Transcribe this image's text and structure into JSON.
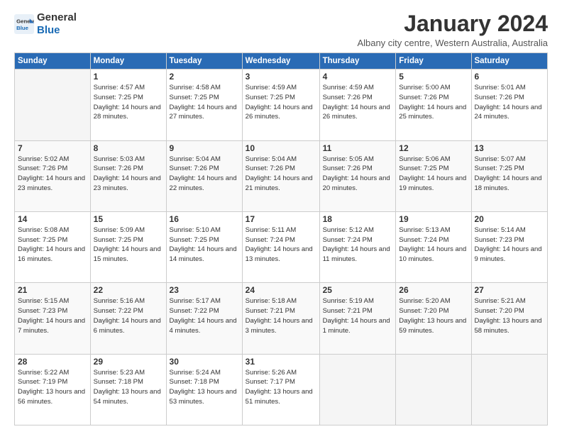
{
  "logo": {
    "line1": "General",
    "line2": "Blue"
  },
  "title": "January 2024",
  "subtitle": "Albany city centre, Western Australia, Australia",
  "days_header": [
    "Sunday",
    "Monday",
    "Tuesday",
    "Wednesday",
    "Thursday",
    "Friday",
    "Saturday"
  ],
  "weeks": [
    [
      {
        "num": "",
        "empty": true
      },
      {
        "num": "1",
        "rise": "4:57 AM",
        "set": "7:25 PM",
        "daylight": "14 hours and 28 minutes."
      },
      {
        "num": "2",
        "rise": "4:58 AM",
        "set": "7:25 PM",
        "daylight": "14 hours and 27 minutes."
      },
      {
        "num": "3",
        "rise": "4:59 AM",
        "set": "7:25 PM",
        "daylight": "14 hours and 26 minutes."
      },
      {
        "num": "4",
        "rise": "4:59 AM",
        "set": "7:26 PM",
        "daylight": "14 hours and 26 minutes."
      },
      {
        "num": "5",
        "rise": "5:00 AM",
        "set": "7:26 PM",
        "daylight": "14 hours and 25 minutes."
      },
      {
        "num": "6",
        "rise": "5:01 AM",
        "set": "7:26 PM",
        "daylight": "14 hours and 24 minutes."
      }
    ],
    [
      {
        "num": "7",
        "rise": "5:02 AM",
        "set": "7:26 PM",
        "daylight": "14 hours and 23 minutes."
      },
      {
        "num": "8",
        "rise": "5:03 AM",
        "set": "7:26 PM",
        "daylight": "14 hours and 23 minutes."
      },
      {
        "num": "9",
        "rise": "5:04 AM",
        "set": "7:26 PM",
        "daylight": "14 hours and 22 minutes."
      },
      {
        "num": "10",
        "rise": "5:04 AM",
        "set": "7:26 PM",
        "daylight": "14 hours and 21 minutes."
      },
      {
        "num": "11",
        "rise": "5:05 AM",
        "set": "7:26 PM",
        "daylight": "14 hours and 20 minutes."
      },
      {
        "num": "12",
        "rise": "5:06 AM",
        "set": "7:25 PM",
        "daylight": "14 hours and 19 minutes."
      },
      {
        "num": "13",
        "rise": "5:07 AM",
        "set": "7:25 PM",
        "daylight": "14 hours and 18 minutes."
      }
    ],
    [
      {
        "num": "14",
        "rise": "5:08 AM",
        "set": "7:25 PM",
        "daylight": "14 hours and 16 minutes."
      },
      {
        "num": "15",
        "rise": "5:09 AM",
        "set": "7:25 PM",
        "daylight": "14 hours and 15 minutes."
      },
      {
        "num": "16",
        "rise": "5:10 AM",
        "set": "7:25 PM",
        "daylight": "14 hours and 14 minutes."
      },
      {
        "num": "17",
        "rise": "5:11 AM",
        "set": "7:24 PM",
        "daylight": "14 hours and 13 minutes."
      },
      {
        "num": "18",
        "rise": "5:12 AM",
        "set": "7:24 PM",
        "daylight": "14 hours and 11 minutes."
      },
      {
        "num": "19",
        "rise": "5:13 AM",
        "set": "7:24 PM",
        "daylight": "14 hours and 10 minutes."
      },
      {
        "num": "20",
        "rise": "5:14 AM",
        "set": "7:23 PM",
        "daylight": "14 hours and 9 minutes."
      }
    ],
    [
      {
        "num": "21",
        "rise": "5:15 AM",
        "set": "7:23 PM",
        "daylight": "14 hours and 7 minutes."
      },
      {
        "num": "22",
        "rise": "5:16 AM",
        "set": "7:22 PM",
        "daylight": "14 hours and 6 minutes."
      },
      {
        "num": "23",
        "rise": "5:17 AM",
        "set": "7:22 PM",
        "daylight": "14 hours and 4 minutes."
      },
      {
        "num": "24",
        "rise": "5:18 AM",
        "set": "7:21 PM",
        "daylight": "14 hours and 3 minutes."
      },
      {
        "num": "25",
        "rise": "5:19 AM",
        "set": "7:21 PM",
        "daylight": "14 hours and 1 minute."
      },
      {
        "num": "26",
        "rise": "5:20 AM",
        "set": "7:20 PM",
        "daylight": "13 hours and 59 minutes."
      },
      {
        "num": "27",
        "rise": "5:21 AM",
        "set": "7:20 PM",
        "daylight": "13 hours and 58 minutes."
      }
    ],
    [
      {
        "num": "28",
        "rise": "5:22 AM",
        "set": "7:19 PM",
        "daylight": "13 hours and 56 minutes."
      },
      {
        "num": "29",
        "rise": "5:23 AM",
        "set": "7:18 PM",
        "daylight": "13 hours and 54 minutes."
      },
      {
        "num": "30",
        "rise": "5:24 AM",
        "set": "7:18 PM",
        "daylight": "13 hours and 53 minutes."
      },
      {
        "num": "31",
        "rise": "5:26 AM",
        "set": "7:17 PM",
        "daylight": "13 hours and 51 minutes."
      },
      {
        "num": "",
        "empty": true
      },
      {
        "num": "",
        "empty": true
      },
      {
        "num": "",
        "empty": true
      }
    ]
  ]
}
